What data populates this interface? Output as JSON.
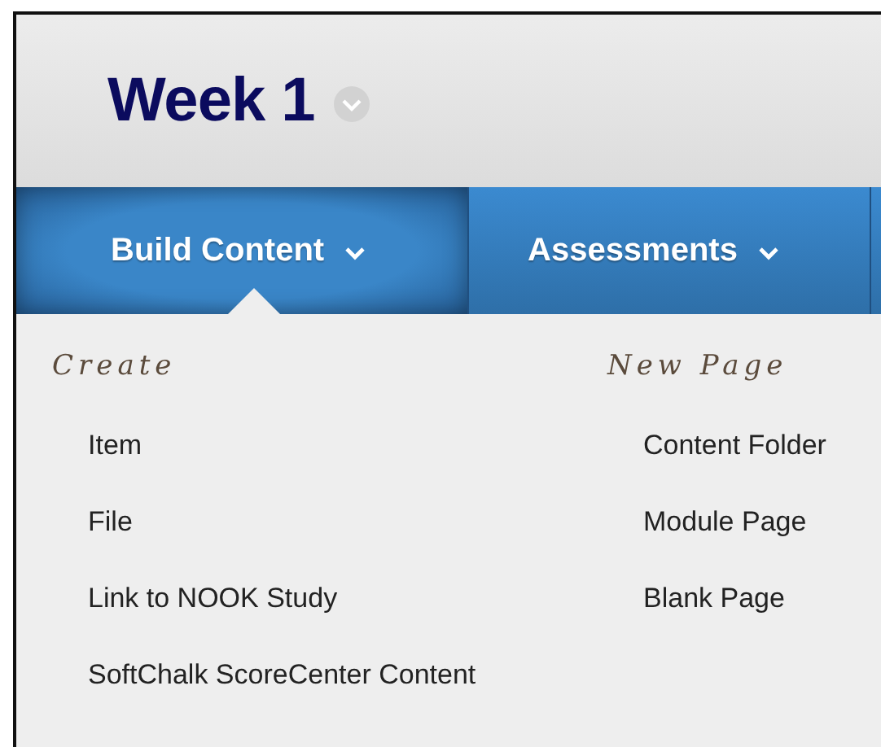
{
  "header": {
    "title": "Week 1"
  },
  "tabs": [
    {
      "label": "Build Content",
      "selected": true
    },
    {
      "label": "Assessments",
      "selected": false
    }
  ],
  "menu": {
    "columns": [
      {
        "heading": "Create",
        "items": [
          "Item",
          "File",
          "Link to NOOK Study",
          "SoftChalk ScoreCenter Content"
        ]
      },
      {
        "heading": "New Page",
        "items": [
          "Content Folder",
          "Module Page",
          "Blank Page"
        ]
      }
    ]
  }
}
